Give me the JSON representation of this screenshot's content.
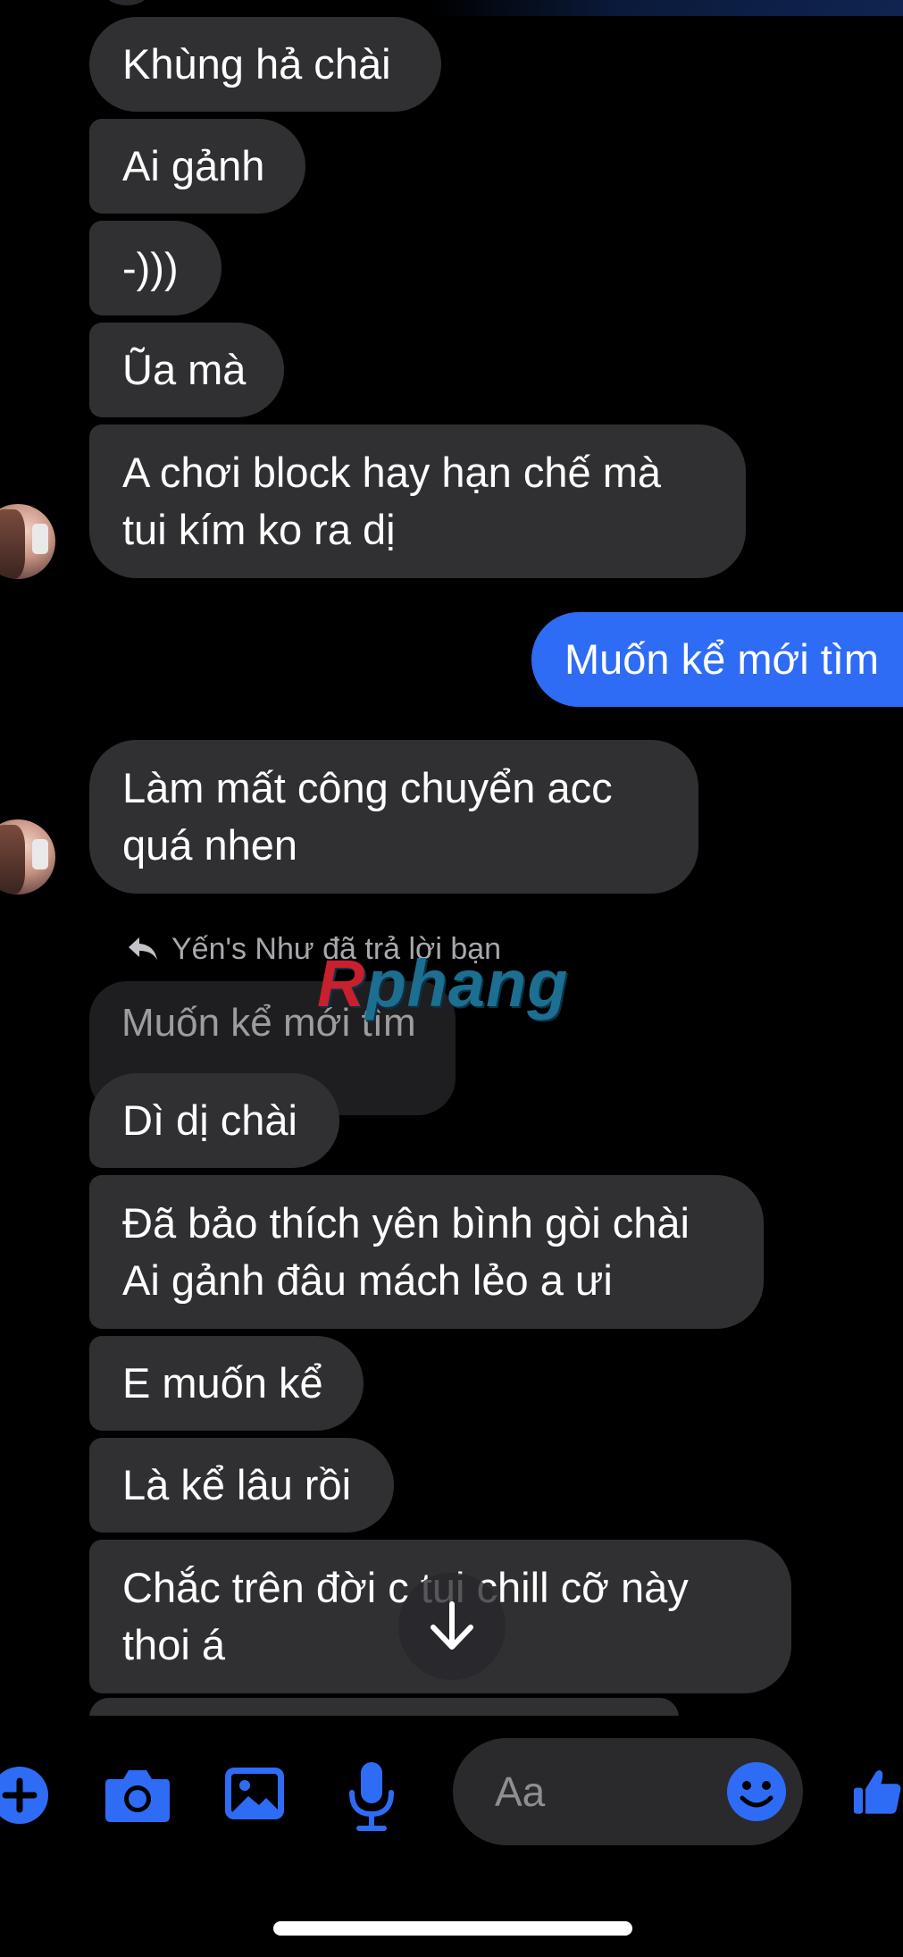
{
  "messages": {
    "m1": "Khùng hả chài",
    "m2": "Ai gảnh",
    "m3": "-)))",
    "m4": "Ũa mà",
    "m5": "A chơi block hay hạn chế mà\ntui kím ko ra dị",
    "out1": "Muốn kể mới tìm",
    "m6": "Làm mất công chuyển acc\nquá nhen",
    "reply_label": "Yến's Như đã trả lời bạn",
    "quoted": "Muốn kể mới tìm",
    "m7": "Dì dị chài",
    "m8": "Đã bảo thích yên bình gòi chài\nAi gảnh đâu mách lẻo a ưi",
    "m9": "E muốn kể",
    "m10": "Là kể lâu rồi",
    "m11": "Chắc trên đời c  tui chill cỡ này\nthoi á"
  },
  "watermark": {
    "r": "R",
    "rest": "phang"
  },
  "composer": {
    "placeholder": "Aa"
  },
  "icons": [
    "plus-icon",
    "camera-icon",
    "image-icon",
    "microphone-icon",
    "emoji-icon",
    "thumbs-up-icon",
    "scroll-down-arrow-icon",
    "reply-arrow-icon"
  ],
  "colors": {
    "accent": "#2f6cf6",
    "incoming_bubble": "#303033",
    "background": "#000000"
  }
}
